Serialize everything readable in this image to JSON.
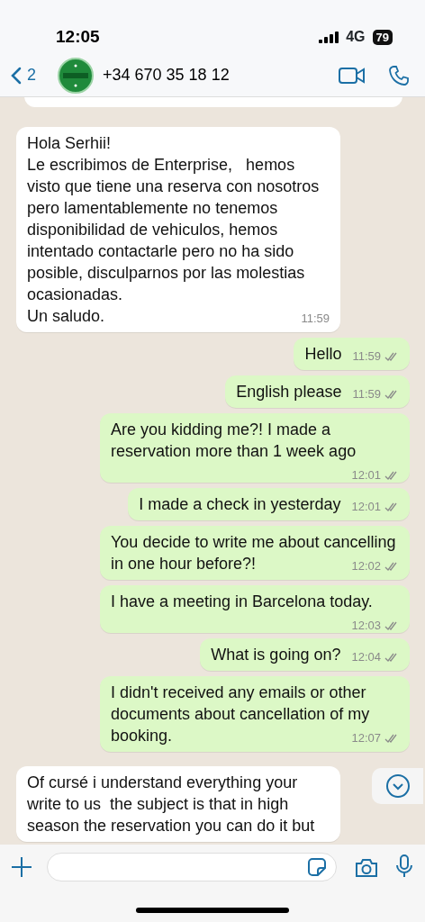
{
  "status_bar": {
    "time": "12:05",
    "network": "4G",
    "battery": "79"
  },
  "header": {
    "back_count": "2",
    "contact": "+34 670 35 18 12"
  },
  "messages": [
    {
      "kind": "incoming"
    },
    {
      "kind": "incoming",
      "text": "Hola Serhii!\nLe escribimos de Enterprise,   hemos visto que tiene una reserva con nosotros pero lamentablemente no tenemos disponibilidad de vehiculos, hemos intentado contactarle pero no ha sido posible, disculparnos por las molestias ocasionadas.\nUn saludo.",
      "time": "11:59"
    },
    {
      "kind": "outgoing",
      "text": "Hello",
      "time": "11:59"
    },
    {
      "kind": "outgoing",
      "text": "English please",
      "time": "11:59"
    },
    {
      "kind": "outgoing",
      "text": "Are you kidding me?! I made a reservation more than 1 week ago",
      "time": "12:01"
    },
    {
      "kind": "outgoing",
      "text": "I made a check in yesterday",
      "time": "12:01"
    },
    {
      "kind": "outgoing",
      "text": "You decide to write me about cancelling in one hour before?!",
      "time": "12:02"
    },
    {
      "kind": "outgoing",
      "text": "I have a meeting in Barcelona today.",
      "time": "12:03"
    },
    {
      "kind": "outgoing",
      "text": "What is going on?",
      "time": "12:04"
    },
    {
      "kind": "outgoing",
      "text": "I didn't received any emails or other documents about cancellation of my booking.",
      "time": "12:07"
    },
    {
      "kind": "incoming",
      "text": "Of cursé i understand everything your write to us  the subject is that in high season the reservation you can do it but"
    }
  ]
}
